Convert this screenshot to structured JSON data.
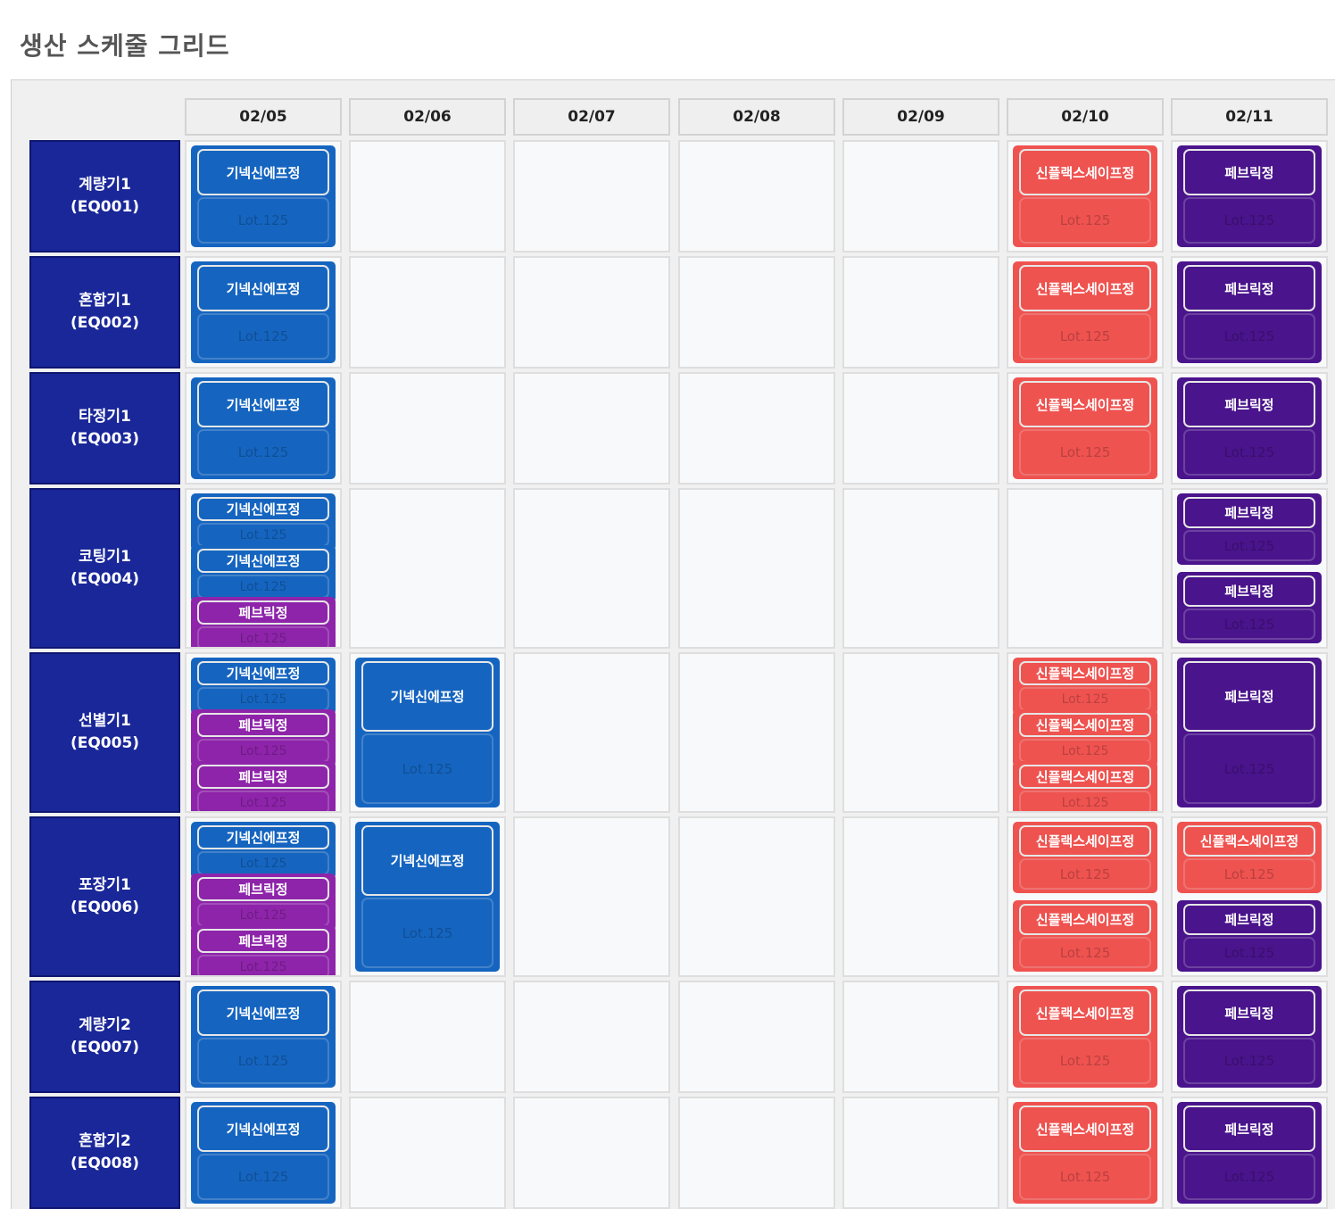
{
  "page": {
    "title": "생산 스케줄 그리드"
  },
  "colors": {
    "blue": "#1565c0",
    "red": "#ef5350",
    "violet": "#4a148c",
    "purple": "#8e24aa",
    "equipment": "#1a2799"
  },
  "dates": [
    "02/05",
    "02/06",
    "02/07",
    "02/08",
    "02/09",
    "02/10",
    "02/11"
  ],
  "rows": [
    {
      "name": "계량기1",
      "code": "(EQ001)",
      "cells": [
        [
          {
            "name": "기넥신에프정",
            "lot": "Lot.125",
            "color": "blue"
          }
        ],
        [],
        [],
        [],
        [],
        [
          {
            "name": "신플랙스세이프정",
            "lot": "Lot.125",
            "color": "red"
          }
        ],
        [
          {
            "name": "페브릭정",
            "lot": "Lot.125",
            "color": "violet"
          }
        ]
      ]
    },
    {
      "name": "혼합기1",
      "code": "(EQ002)",
      "cells": [
        [
          {
            "name": "기넥신에프정",
            "lot": "Lot.125",
            "color": "blue"
          }
        ],
        [],
        [],
        [],
        [],
        [
          {
            "name": "신플랙스세이프정",
            "lot": "Lot.125",
            "color": "red"
          }
        ],
        [
          {
            "name": "페브릭정",
            "lot": "Lot.125",
            "color": "violet"
          }
        ]
      ]
    },
    {
      "name": "타정기1",
      "code": "(EQ003)",
      "cells": [
        [
          {
            "name": "기넥신에프정",
            "lot": "Lot.125",
            "color": "blue"
          }
        ],
        [],
        [],
        [],
        [],
        [
          {
            "name": "신플랙스세이프정",
            "lot": "Lot.125",
            "color": "red"
          }
        ],
        [
          {
            "name": "페브릭정",
            "lot": "Lot.125",
            "color": "violet"
          }
        ]
      ]
    },
    {
      "name": "코팅기1",
      "code": "(EQ004)",
      "cells": [
        [
          {
            "name": "기넥신에프정",
            "lot": "Lot.125",
            "color": "blue"
          },
          {
            "name": "기넥신에프정",
            "lot": "Lot.125",
            "color": "blue"
          },
          {
            "name": "페브릭정",
            "lot": "Lot.125",
            "color": "purple"
          }
        ],
        [],
        [],
        [],
        [],
        [],
        [
          {
            "name": "페브릭정",
            "lot": "Lot.125",
            "color": "violet"
          },
          {
            "name": "페브릭정",
            "lot": "Lot.125",
            "color": "violet"
          }
        ]
      ]
    },
    {
      "name": "선별기1",
      "code": "(EQ005)",
      "cells": [
        [
          {
            "name": "기넥신에프정",
            "lot": "Lot.125",
            "color": "blue"
          },
          {
            "name": "페브릭정",
            "lot": "Lot.125",
            "color": "purple"
          },
          {
            "name": "페브릭정",
            "lot": "Lot.125",
            "color": "purple"
          }
        ],
        [
          {
            "name": "기넥신에프정",
            "lot": "Lot.125",
            "color": "blue"
          }
        ],
        [],
        [],
        [],
        [
          {
            "name": "신플랙스세이프정",
            "lot": "Lot.125",
            "color": "red"
          },
          {
            "name": "신플랙스세이프정",
            "lot": "Lot.125",
            "color": "red"
          },
          {
            "name": "신플랙스세이프정",
            "lot": "Lot.125",
            "color": "red"
          }
        ],
        [
          {
            "name": "페브릭정",
            "lot": "Lot.125",
            "color": "violet"
          }
        ]
      ]
    },
    {
      "name": "포장기1",
      "code": "(EQ006)",
      "cells": [
        [
          {
            "name": "기넥신에프정",
            "lot": "Lot.125",
            "color": "blue"
          },
          {
            "name": "페브릭정",
            "lot": "Lot.125",
            "color": "purple"
          },
          {
            "name": "페브릭정",
            "lot": "Lot.125",
            "color": "purple"
          }
        ],
        [
          {
            "name": "기넥신에프정",
            "lot": "Lot.125",
            "color": "blue"
          }
        ],
        [],
        [],
        [],
        [
          {
            "name": "신플랙스세이프정",
            "lot": "Lot.125",
            "color": "red"
          },
          {
            "name": "신플랙스세이프정",
            "lot": "Lot.125",
            "color": "red"
          }
        ],
        [
          {
            "name": "신플랙스세이프정",
            "lot": "Lot.125",
            "color": "red"
          },
          {
            "name": "페브릭정",
            "lot": "Lot.125",
            "color": "violet"
          }
        ]
      ]
    },
    {
      "name": "계량기2",
      "code": "(EQ007)",
      "cells": [
        [
          {
            "name": "기넥신에프정",
            "lot": "Lot.125",
            "color": "blue"
          }
        ],
        [],
        [],
        [],
        [],
        [
          {
            "name": "신플랙스세이프정",
            "lot": "Lot.125",
            "color": "red"
          }
        ],
        [
          {
            "name": "페브릭정",
            "lot": "Lot.125",
            "color": "violet"
          }
        ]
      ]
    },
    {
      "name": "혼합기2",
      "code": "(EQ008)",
      "cells": [
        [
          {
            "name": "기넥신에프정",
            "lot": "Lot.125",
            "color": "blue"
          }
        ],
        [],
        [],
        [],
        [],
        [
          {
            "name": "신플랙스세이프정",
            "lot": "Lot.125",
            "color": "red"
          }
        ],
        [
          {
            "name": "페브릭정",
            "lot": "Lot.125",
            "color": "violet"
          }
        ]
      ]
    }
  ]
}
